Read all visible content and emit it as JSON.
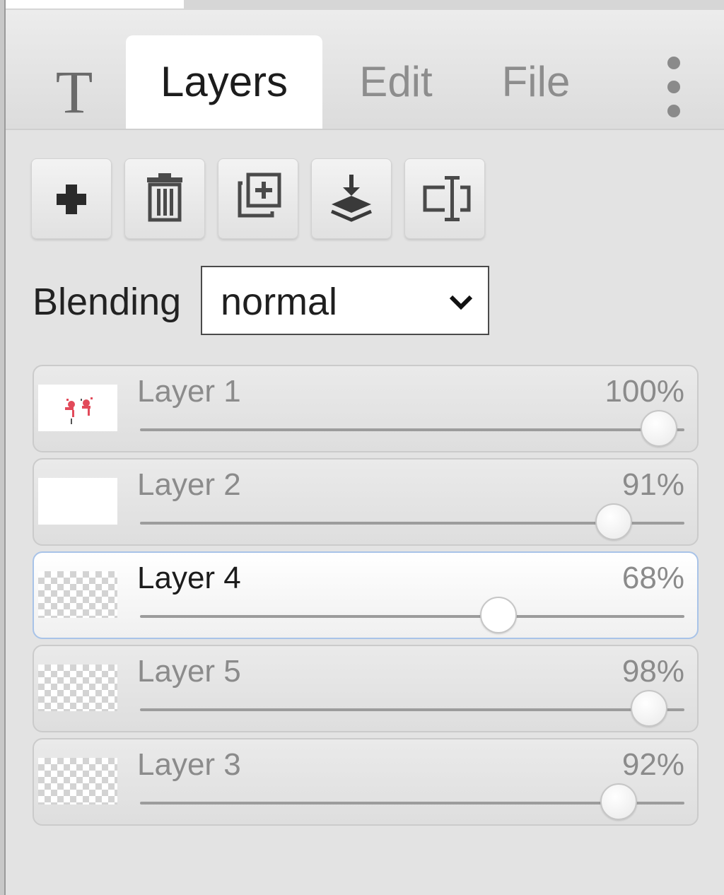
{
  "tabs": {
    "text_tool_icon": "T",
    "items": [
      {
        "label": "Layers",
        "active": true
      },
      {
        "label": "Edit",
        "active": false
      },
      {
        "label": "File",
        "active": false
      }
    ],
    "more_icon": "kebab-icon"
  },
  "toolbar": {
    "buttons": [
      {
        "icon": "plus-icon",
        "action": "add-layer"
      },
      {
        "icon": "trash-icon",
        "action": "delete-layer"
      },
      {
        "icon": "duplicate-icon",
        "action": "duplicate-layer"
      },
      {
        "icon": "merge-down-icon",
        "action": "merge-down"
      },
      {
        "icon": "rename-icon",
        "action": "rename-layer"
      }
    ]
  },
  "blending": {
    "label": "Blending",
    "value": "normal"
  },
  "layers": [
    {
      "name": "Layer 1",
      "opacity_label": "100%",
      "opacity": 1.0,
      "thumbnail": "white-with-red-marks",
      "selected": false
    },
    {
      "name": "Layer 2",
      "opacity_label": "91%",
      "opacity": 0.91,
      "thumbnail": "white",
      "selected": false
    },
    {
      "name": "Layer 4",
      "opacity_label": "68%",
      "opacity": 0.68,
      "thumbnail": "transparent",
      "selected": true
    },
    {
      "name": "Layer 5",
      "opacity_label": "98%",
      "opacity": 0.98,
      "thumbnail": "transparent",
      "selected": false
    },
    {
      "name": "Layer 3",
      "opacity_label": "92%",
      "opacity": 0.92,
      "thumbnail": "transparent",
      "selected": false
    }
  ]
}
